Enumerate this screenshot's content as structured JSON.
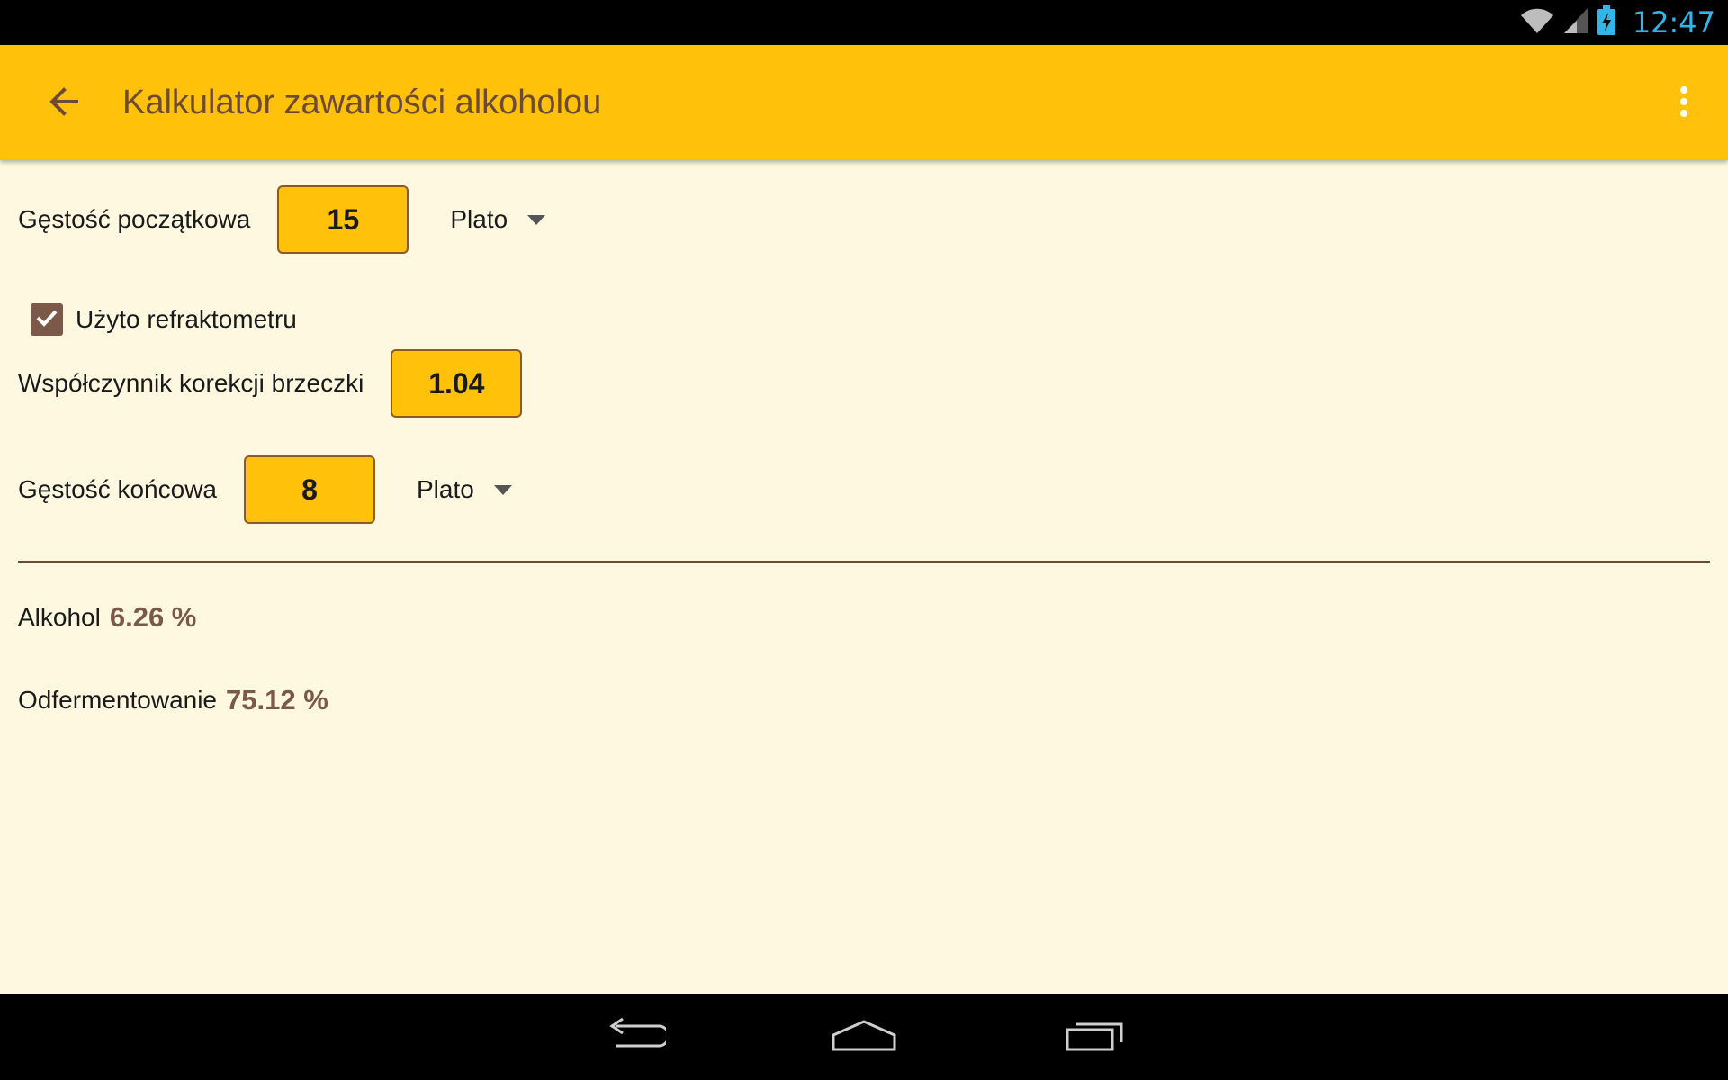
{
  "status_bar": {
    "time": "12:47",
    "icons": [
      "wifi-icon",
      "signal-icon",
      "battery-charging-icon"
    ],
    "time_color": "#33b5e5"
  },
  "action_bar": {
    "title": "Kalkulator zawartości alkoholou",
    "back_icon": "arrow-back-icon",
    "overflow_icon": "overflow-menu-icon",
    "background": "#ffc10a"
  },
  "form": {
    "original_gravity": {
      "label": "Gęstość początkowa",
      "value": "15",
      "unit": "Plato"
    },
    "refractometer": {
      "label": "Użyto refraktometru",
      "checked": true
    },
    "wort_correction": {
      "label": "Współczynnik korekcji brzeczki",
      "value": "1.04"
    },
    "final_gravity": {
      "label": "Gęstość końcowa",
      "value": "8",
      "unit": "Plato"
    }
  },
  "results": {
    "alcohol": {
      "label": "Alkohol",
      "value": "6.26 %"
    },
    "attenuation": {
      "label": "Odfermentowanie",
      "value": "75.12 %"
    }
  },
  "nav_bar": {
    "icons": [
      "nav-back-icon",
      "nav-home-icon",
      "nav-recents-icon"
    ]
  }
}
